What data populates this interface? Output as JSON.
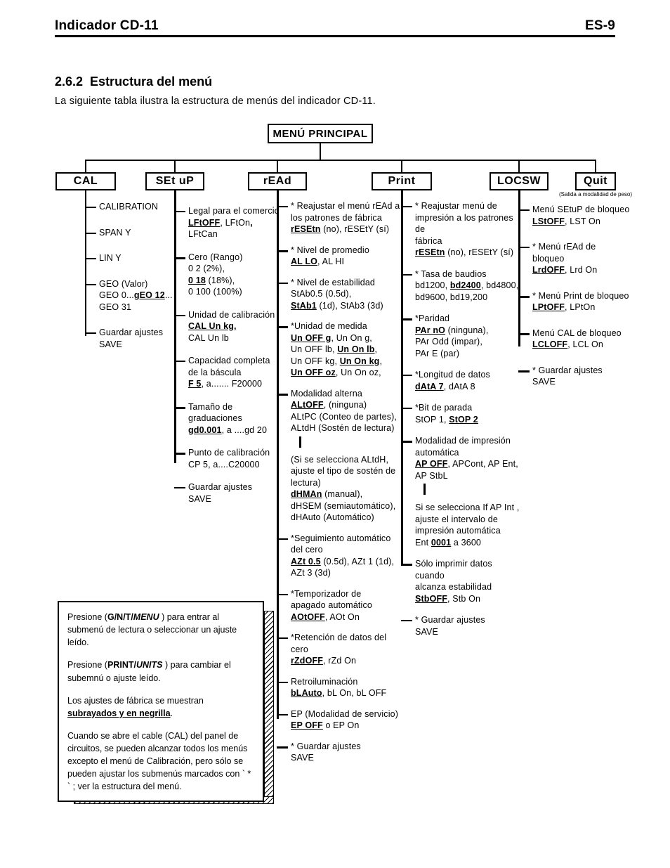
{
  "header": {
    "left_title": "Indicador CD-11",
    "right_page": "ES-9"
  },
  "section": {
    "number": "2.6.2",
    "title": "Estructura del menú",
    "intro": "La siguiente tabla ilustra la estructura de menús del indicador CD-11."
  },
  "diagram": {
    "root": {
      "label": "MENÚ PRINCIPAL"
    },
    "nodes": {
      "cal": "CAL",
      "setup": "SEt uP",
      "read": "rEAd",
      "print": "Print",
      "locsw": "LOCSW",
      "quit": "Quit"
    },
    "quit_caption": "(Salida a modalidad de peso)"
  },
  "cal_items": [
    {
      "lines": [
        {
          "runs": [
            {
              "t": "CALIBRATION"
            }
          ]
        }
      ]
    },
    {
      "lines": [
        {
          "runs": [
            {
              "t": "SPAN  Y"
            }
          ]
        }
      ]
    },
    {
      "lines": [
        {
          "runs": [
            {
              "t": "LIN Y"
            }
          ]
        }
      ]
    },
    {
      "lines": [
        {
          "runs": [
            {
              "t": "GEO  (Valor)"
            }
          ]
        },
        {
          "runs": [
            {
              "t": "GEO 0..."
            },
            {
              "t": "gEO 12",
              "s": "bu"
            },
            {
              "t": "..."
            }
          ]
        },
        {
          "runs": [
            {
              "t": "GEO 31"
            }
          ]
        }
      ]
    },
    {
      "lines": [
        {
          "runs": [
            {
              "t": "Guardar  ajustes"
            }
          ]
        },
        {
          "runs": [
            {
              "t": "SAVE"
            }
          ]
        }
      ]
    }
  ],
  "setup_items": [
    {
      "lines": [
        {
          "runs": [
            {
              "t": "Legal  para  el  comercio"
            }
          ]
        },
        {
          "runs": [
            {
              "t": "LFtOFF",
              "s": "bu"
            },
            {
              "t": ", LFtOn"
            },
            {
              "t": ",",
              "s": "bold"
            },
            {
              "t": " LFtCan"
            }
          ]
        }
      ]
    },
    {
      "thick": true,
      "lines": [
        {
          "runs": [
            {
              "t": "Cero  (Rango)"
            }
          ]
        },
        {
          "runs": [
            {
              "t": "0 2 (2%),"
            }
          ]
        },
        {
          "runs": [
            {
              "t": "0 18",
              "s": "bu"
            },
            {
              "t": " (18%),"
            }
          ]
        },
        {
          "runs": [
            {
              "t": "0 100 (100%)"
            }
          ]
        }
      ]
    },
    {
      "lines": [
        {
          "runs": [
            {
              "t": "Unidad  de  calibración"
            }
          ]
        },
        {
          "runs": [
            {
              "t": "CAL  Un  kg,",
              "s": "bu"
            }
          ]
        },
        {
          "runs": [
            {
              "t": "CAL Un lb"
            }
          ]
        }
      ]
    },
    {
      "lines": [
        {
          "runs": [
            {
              "t": "Capacidad  completa"
            }
          ]
        },
        {
          "runs": [
            {
              "t": "de la báscula"
            }
          ]
        },
        {
          "runs": [
            {
              "t": "F 5",
              "s": "bu"
            },
            {
              "t": ", a....... F20000"
            }
          ]
        }
      ]
    },
    {
      "thick": true,
      "lines": [
        {
          "runs": [
            {
              "t": "Tamaño  de"
            }
          ]
        },
        {
          "runs": [
            {
              "t": "graduaciones"
            }
          ]
        },
        {
          "runs": [
            {
              "t": "gd0.001",
              "s": "bu"
            },
            {
              "t": ", a ....gd 20"
            }
          ]
        }
      ]
    },
    {
      "thick": true,
      "lines": [
        {
          "runs": [
            {
              "t": "Punto  de  calibración"
            }
          ]
        },
        {
          "runs": [
            {
              "t": "CP 5, a....C20000"
            }
          ]
        }
      ]
    },
    {
      "lines": [
        {
          "runs": [
            {
              "t": "Guardar  ajustes"
            }
          ]
        },
        {
          "runs": [
            {
              "t": "SAVE"
            }
          ]
        }
      ]
    }
  ],
  "read_items": [
    {
      "lines": [
        {
          "runs": [
            {
              "t": "*  Reajustar  el  menú  rEAd  a"
            }
          ]
        },
        {
          "runs": [
            {
              "t": "los  patrones  de  fábrica"
            }
          ]
        },
        {
          "runs": [
            {
              "t": "rESEtn",
              "s": "bu"
            },
            {
              "t": " (no),  rESEtY  (sí)"
            }
          ]
        }
      ]
    },
    {
      "thick": true,
      "lines": [
        {
          "runs": [
            {
              "t": "*  Nivel  de  promedio"
            }
          ]
        },
        {
          "runs": [
            {
              "t": "AL LO",
              "s": "bu"
            },
            {
              "t": ", AL HI"
            }
          ]
        }
      ]
    },
    {
      "lines": [
        {
          "runs": [
            {
              "t": "*  Nivel  de  estabilidad"
            }
          ]
        },
        {
          "runs": [
            {
              "t": "StAb0.5  (0.5d),"
            }
          ]
        },
        {
          "runs": [
            {
              "t": "StAb1",
              "s": "bu"
            },
            {
              "t": "  (1d),  StAb3  (3d)"
            }
          ]
        }
      ]
    },
    {
      "thick": true,
      "lines": [
        {
          "runs": [
            {
              "t": "*Unidad  de  medida"
            }
          ]
        },
        {
          "runs": [
            {
              "t": "Un OFF g",
              "s": "bu"
            },
            {
              "t": ", Un On g,"
            }
          ]
        },
        {
          "runs": [
            {
              "t": "Un OFF lb, "
            },
            {
              "t": "Un On lb",
              "s": "bu"
            },
            {
              "t": ","
            }
          ]
        },
        {
          "runs": [
            {
              "t": "Un OFF kg, "
            },
            {
              "t": "Un On kg",
              "s": "bu"
            },
            {
              "t": ","
            }
          ]
        },
        {
          "runs": [
            {
              "t": "Un OFF oz",
              "s": "bu"
            },
            {
              "t": ", Un On oz,"
            }
          ]
        }
      ]
    },
    {
      "thick": true,
      "subtick": true,
      "lines": [
        {
          "runs": [
            {
              "t": "Modalidad  alterna"
            }
          ]
        },
        {
          "runs": [
            {
              "t": "ALtOFF",
              "s": "bu"
            },
            {
              "t": ",  (ninguna)"
            }
          ]
        },
        {
          "runs": [
            {
              "t": "ALtPC  (Conteo  de  partes),"
            }
          ]
        },
        {
          "runs": [
            {
              "t": "ALtdH  (Sostén  de  lectura)"
            }
          ]
        }
      ]
    },
    {
      "no_tick": true,
      "lines": [
        {
          "runs": [
            {
              "t": "(Si  se  selecciona  ALtdH,"
            }
          ]
        },
        {
          "runs": [
            {
              "t": "ajuste  el  tipo  de  sostén  de"
            }
          ]
        },
        {
          "runs": [
            {
              "t": "lectura)"
            }
          ]
        },
        {
          "runs": [
            {
              "t": "dHMAn",
              "s": "bu"
            },
            {
              "t": "  (manual),"
            }
          ]
        },
        {
          "runs": [
            {
              "t": "dHSEM  (semiautomático),"
            }
          ]
        },
        {
          "runs": [
            {
              "t": "dHAuto  (Automático)"
            }
          ]
        }
      ]
    },
    {
      "lines": [
        {
          "runs": [
            {
              "t": "*Seguimiento  automático"
            }
          ]
        },
        {
          "runs": [
            {
              "t": "del  cero"
            }
          ]
        },
        {
          "runs": [
            {
              "t": "AZt 0.5",
              "s": "bu"
            },
            {
              "t": "  (0.5d),  AZt 1  (1d),"
            }
          ]
        },
        {
          "runs": [
            {
              "t": "AZt 3  (3d)"
            }
          ]
        }
      ]
    },
    {
      "lines": [
        {
          "runs": [
            {
              "t": "*Temporizador  de"
            }
          ]
        },
        {
          "runs": [
            {
              "t": "apagado  automático"
            }
          ]
        },
        {
          "runs": [
            {
              "t": "AOtOFF",
              "s": "bu"
            },
            {
              "t": ",  AOt On"
            }
          ]
        }
      ]
    },
    {
      "lines": [
        {
          "runs": [
            {
              "t": "*Retención  de  datos  del"
            }
          ]
        },
        {
          "runs": [
            {
              "t": "cero"
            }
          ]
        },
        {
          "runs": [
            {
              "t": "rZdOFF",
              "s": "bu"
            },
            {
              "t": ",  rZd On"
            }
          ]
        }
      ]
    },
    {
      "lines": [
        {
          "runs": [
            {
              "t": "Retroiluminación"
            }
          ]
        },
        {
          "runs": [
            {
              "t": "bLAuto",
              "s": "bu"
            },
            {
              "t": ", bL On, bL OFF"
            }
          ]
        }
      ]
    },
    {
      "lines": [
        {
          "runs": [
            {
              "t": "EP  (Modalidad  de  servicio)"
            }
          ]
        },
        {
          "runs": [
            {
              "t": "EP OFF",
              "s": "bu"
            },
            {
              "t": " o EP On"
            }
          ]
        }
      ]
    },
    {
      "thick": true,
      "lines": [
        {
          "runs": [
            {
              "t": "*  Guardar  ajustes"
            }
          ]
        },
        {
          "runs": [
            {
              "t": "   SAVE"
            }
          ]
        }
      ]
    }
  ],
  "print_items": [
    {
      "lines": [
        {
          "runs": [
            {
              "t": "*  Reajustar  menú  de"
            }
          ]
        },
        {
          "runs": [
            {
              "t": "impresión  a  los  patrones  de"
            }
          ]
        },
        {
          "runs": [
            {
              "t": "fábrica"
            }
          ]
        },
        {
          "runs": [
            {
              "t": "rESEtn",
              "s": "bu"
            },
            {
              "t": " (no),  rESEtY  (sí)"
            }
          ]
        }
      ]
    },
    {
      "lines": [
        {
          "runs": [
            {
              "t": "*  Tasa  de  baudios"
            }
          ]
        },
        {
          "runs": [
            {
              "t": "bd1200,  "
            },
            {
              "t": "bd2400",
              "s": "bu"
            },
            {
              "t": ",  bd4800,"
            }
          ]
        },
        {
          "runs": [
            {
              "t": "bd9600,  bd19,200"
            }
          ]
        }
      ]
    },
    {
      "thick": true,
      "lines": [
        {
          "runs": [
            {
              "t": "*Paridad"
            }
          ]
        },
        {
          "runs": [
            {
              "t": "PAr nO",
              "s": "bu"
            },
            {
              "t": "  (ninguna),"
            }
          ]
        },
        {
          "runs": [
            {
              "t": "PAr Odd  (impar),"
            }
          ]
        },
        {
          "runs": [
            {
              "t": "PAr E  (par)"
            }
          ]
        }
      ]
    },
    {
      "lines": [
        {
          "runs": [
            {
              "t": "*Longitud  de  datos"
            }
          ]
        },
        {
          "runs": [
            {
              "t": "dAtA 7",
              "s": "bu"
            },
            {
              "t": ",  dAtA 8"
            }
          ]
        }
      ]
    },
    {
      "lines": [
        {
          "runs": [
            {
              "t": "*Bit  de  parada"
            }
          ]
        },
        {
          "runs": [
            {
              "t": "StOP 1,  "
            },
            {
              "t": "StOP 2",
              "s": "bu"
            }
          ]
        }
      ]
    },
    {
      "thick": true,
      "subtick": true,
      "lines": [
        {
          "runs": [
            {
              "t": "Modalidad  de  impresión"
            }
          ]
        },
        {
          "runs": [
            {
              "t": "automática"
            }
          ]
        },
        {
          "runs": [
            {
              "t": "AP OFF",
              "s": "bu"
            },
            {
              "t": ", APCont, AP Ent,"
            }
          ]
        },
        {
          "runs": [
            {
              "t": "AP StbL"
            }
          ]
        }
      ]
    },
    {
      "no_tick": true,
      "lines": [
        {
          "runs": [
            {
              "t": "Si  se  selecciona  If AP Int ,"
            }
          ]
        },
        {
          "runs": [
            {
              "t": "ajuste  el  intervalo  de"
            }
          ]
        },
        {
          "runs": [
            {
              "t": "impresión  automática"
            }
          ]
        },
        {
          "runs": [
            {
              "t": "Ent  "
            },
            {
              "t": "0001",
              "s": "bu"
            },
            {
              "t": "  a 3600"
            }
          ]
        }
      ]
    },
    {
      "thick": true,
      "lines": [
        {
          "runs": [
            {
              "t": "Sólo  imprimir  datos  cuando"
            }
          ]
        },
        {
          "runs": [
            {
              "t": "alcanza  estabilidad"
            }
          ]
        },
        {
          "runs": [
            {
              "t": "StbOFF",
              "s": "bu"
            },
            {
              "t": ",  Stb On"
            }
          ]
        }
      ]
    },
    {
      "lines": [
        {
          "runs": [
            {
              "t": "*  Guardar  ajustes"
            }
          ]
        },
        {
          "runs": [
            {
              "t": "   SAVE"
            }
          ]
        }
      ]
    }
  ],
  "locsw_items": [
    {
      "lines": [
        {
          "runs": [
            {
              "t": "Menú  SEtuP  de  bloqueo"
            }
          ]
        },
        {
          "runs": [
            {
              "t": "LStOFF",
              "s": "bu"
            },
            {
              "t": ",  LST On"
            }
          ]
        }
      ]
    },
    {
      "lines": [
        {
          "runs": [
            {
              "t": "*  Menú  rEAd  de"
            }
          ]
        },
        {
          "runs": [
            {
              "t": "bloqueo"
            }
          ]
        },
        {
          "runs": [
            {
              "t": "LrdOFF",
              "s": "bu"
            },
            {
              "t": ",  Lrd On"
            }
          ]
        }
      ]
    },
    {
      "thick": true,
      "lines": [
        {
          "runs": [
            {
              "t": "*  Menú  Print  de  bloqueo"
            }
          ]
        },
        {
          "runs": [
            {
              "t": "LPtOFF",
              "s": "bu"
            },
            {
              "t": ",  LPtOn"
            }
          ]
        }
      ]
    },
    {
      "thick": true,
      "lines": [
        {
          "runs": [
            {
              "t": "Menú  CAL  de  bloqueo"
            }
          ]
        },
        {
          "runs": [
            {
              "t": "LCLOFF",
              "s": "bu"
            },
            {
              "t": ",  LCL On"
            }
          ]
        }
      ]
    },
    {
      "thick": true,
      "lines": [
        {
          "runs": [
            {
              "t": "*  Guardar  ajustes"
            }
          ]
        },
        {
          "runs": [
            {
              "t": "   SAVE"
            }
          ]
        }
      ]
    }
  ],
  "note": {
    "paragraphs": [
      [
        {
          "t": "Presione ("
        },
        {
          "t": "G/N/T/",
          "s": "bold"
        },
        {
          "t": "MENU",
          "s": "boldital"
        },
        {
          "t": " ) para entrar al submenú de lectura o seleccionar un ajuste leído."
        }
      ],
      [
        {
          "t": "Presione ("
        },
        {
          "t": "PRINT/",
          "s": "bold"
        },
        {
          "t": "UNITS",
          "s": "boldital"
        },
        {
          "t": " ) para cambiar el subemnú o ajuste leído."
        }
      ],
      [
        {
          "t": "Los ajustes de fábrica se muestran "
        },
        {
          "t": "subrayados y en negrilla",
          "s": "bu"
        },
        {
          "t": "."
        }
      ],
      [
        {
          "t": "Cuando se abre el cable (CAL) del panel de circuitos, se pueden alcanzar todos los menús excepto el menú de Calibración, pero sólo se pueden ajustar los submenús marcados con ` * ` ; ver la estructura del menú."
        }
      ]
    ]
  }
}
